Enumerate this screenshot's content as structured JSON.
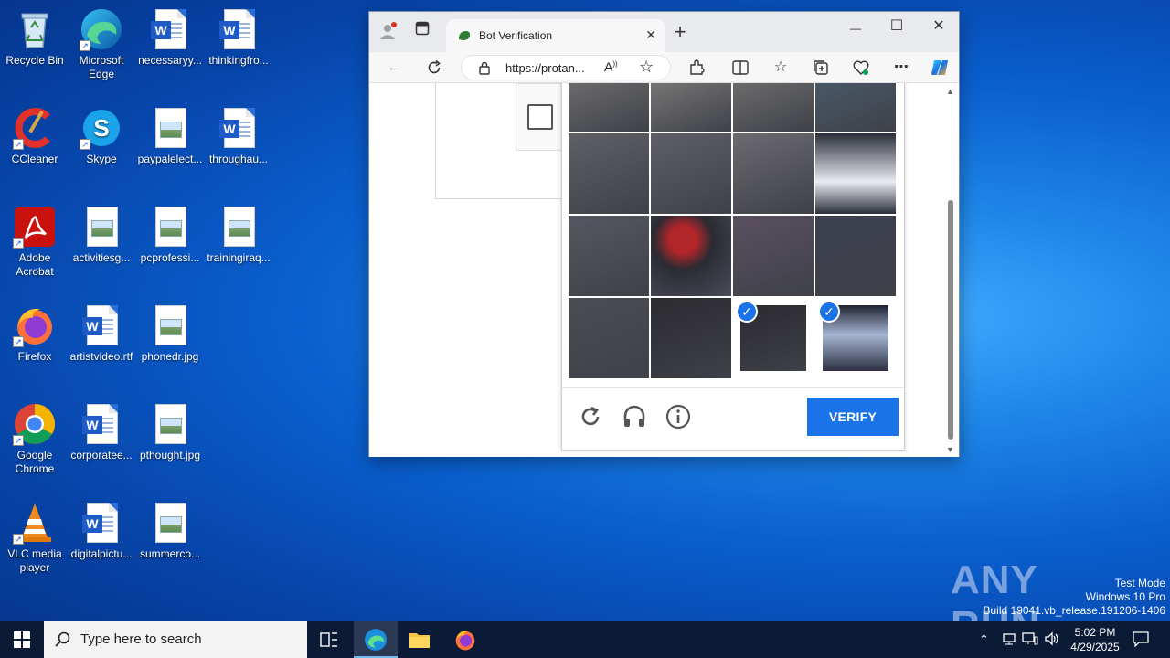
{
  "desktop": {
    "icons": [
      {
        "label": "Recycle Bin",
        "icon": "recycle-bin-icon"
      },
      {
        "label": "Microsoft Edge",
        "icon": "edge-icon"
      },
      {
        "label": "necessaryy...",
        "icon": "word-document-icon"
      },
      {
        "label": "thinkingfro...",
        "icon": "word-document-icon"
      },
      {
        "label": "CCleaner",
        "icon": "ccleaner-icon"
      },
      {
        "label": "Skype",
        "icon": "skype-icon"
      },
      {
        "label": "paypalelect...",
        "icon": "image-file-icon"
      },
      {
        "label": "throughau...",
        "icon": "word-document-icon"
      },
      {
        "label": "Adobe Acrobat",
        "icon": "acrobat-icon"
      },
      {
        "label": "activitiesg...",
        "icon": "image-file-icon"
      },
      {
        "label": "pcprofessi...",
        "icon": "image-file-icon"
      },
      {
        "label": "trainingiraq...",
        "icon": "image-file-icon"
      },
      {
        "label": "Firefox",
        "icon": "firefox-icon"
      },
      {
        "label": "artistvideo.rtf",
        "icon": "word-document-icon"
      },
      {
        "label": "phonedr.jpg",
        "icon": "image-file-icon"
      },
      {
        "label": "Google Chrome",
        "icon": "chrome-icon"
      },
      {
        "label": "corporatee...",
        "icon": "word-document-icon"
      },
      {
        "label": "pthought.jpg",
        "icon": "image-file-icon"
      },
      {
        "label": "VLC media player",
        "icon": "vlc-icon"
      },
      {
        "label": "digitalpictu...",
        "icon": "word-document-icon"
      },
      {
        "label": "summerco...",
        "icon": "image-file-icon"
      }
    ]
  },
  "browser": {
    "tab_title": "Bot Verification",
    "url": "https://protan...",
    "window_controls": {
      "minimize": "—",
      "maximize": "☐",
      "close": "✕"
    },
    "new_tab": "+"
  },
  "captcha": {
    "verify_label": "VERIFY",
    "selected_tiles": [
      14,
      15
    ],
    "grid_size": 4
  },
  "watermark": {
    "brand": "ANY RUN",
    "line1": "Test Mode",
    "line2": "Windows 10 Pro",
    "line3": "Build 19041.vb_release.191206-1406"
  },
  "taskbar": {
    "search_placeholder": "Type here to search",
    "time": "5:02 PM",
    "date": "4/29/2025"
  },
  "colors": {
    "accent": "#1a73e8",
    "taskbar": "#0c1b35"
  }
}
